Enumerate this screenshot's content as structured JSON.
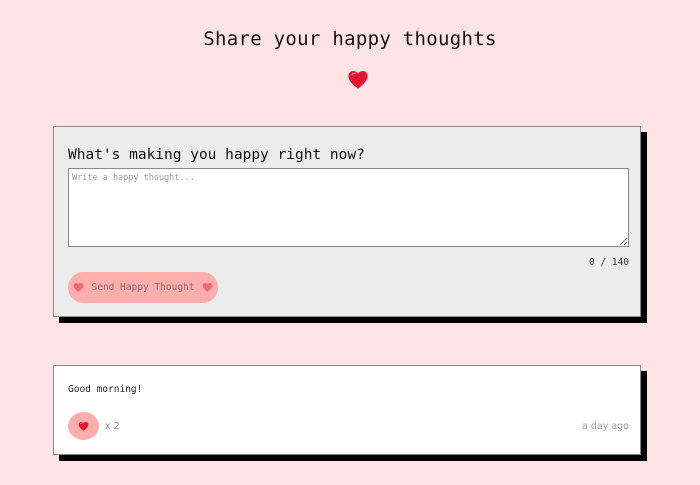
{
  "header": {
    "title": "Share your happy thoughts",
    "icon": "heart-icon"
  },
  "form": {
    "question": "What's making you happy right now?",
    "input_value": "",
    "input_placeholder": "Write a happy thought...",
    "char_count": 0,
    "char_limit": 140,
    "char_counter": "0 / 140",
    "send_label": "Send Happy Thought",
    "send_icon": "heart-icon",
    "send_disabled": true
  },
  "thoughts": [
    {
      "message": "Good morning!",
      "likes": 2,
      "likes_label": "x 2",
      "time": "a day ago",
      "like_icon": "heart-icon"
    }
  ],
  "colors": {
    "background": "#ffe4e6",
    "card_form": "#ececec",
    "card_thought": "#ffffff",
    "button": "#ffadad",
    "heart": "#e8142f",
    "shadow": "#000000"
  }
}
